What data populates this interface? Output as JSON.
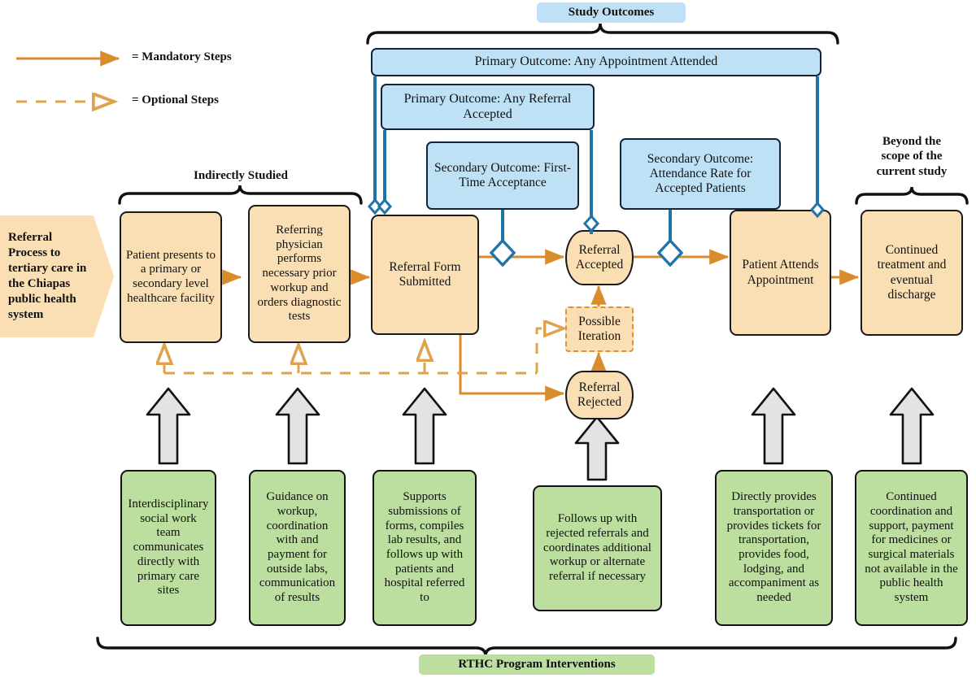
{
  "legend": {
    "mandatory": "= Mandatory Steps",
    "optional": "= Optional Steps"
  },
  "brackets": {
    "study_outcomes": "Study Outcomes",
    "indirectly_studied": "Indirectly Studied",
    "beyond_scope": "Beyond the\nscope of the\ncurrent study",
    "beyond_scope_l1": "Beyond the",
    "beyond_scope_l2": "scope of the",
    "beyond_scope_l3": "current study",
    "rthc": "RTHC Program Interventions"
  },
  "entry_label": "Referral Process to tertiary care in the Chiapas public health system",
  "outcomes": [
    {
      "id": "any-appointment-attended",
      "label": "Primary Outcome: Any Appointment Attended"
    },
    {
      "id": "any-referral-accepted",
      "label": "Primary Outcome: Any Referral Accepted"
    },
    {
      "id": "first-time-acceptance",
      "label": "Secondary Outcome: First-Time Acceptance"
    },
    {
      "id": "attendance-rate",
      "label": "Secondary Outcome: Attendance Rate for Accepted Patients"
    }
  ],
  "process": [
    {
      "id": "patient-presents",
      "label": "Patient presents to a primary or secondary level healthcare facility"
    },
    {
      "id": "referring-physician",
      "label": "Referring physician performs necessary prior workup and orders diagnostic tests"
    },
    {
      "id": "referral-form-submitted",
      "label": "Referral Form Submitted"
    },
    {
      "id": "referral-accepted",
      "label": "Referral Accepted"
    },
    {
      "id": "referral-rejected",
      "label": "Referral Rejected"
    },
    {
      "id": "possible-iteration",
      "label": "Possible Iteration"
    },
    {
      "id": "patient-attends-appointment",
      "label": "Patient Attends Appointment"
    },
    {
      "id": "continued-treatment",
      "label": "Continued treatment and eventual discharge"
    }
  ],
  "interventions": [
    {
      "id": "social-work-team",
      "label": "Interdisciplinary social work team communicates directly with primary care sites"
    },
    {
      "id": "workup-guidance",
      "label": "Guidance on workup, coordination with and payment for outside labs, communication of results"
    },
    {
      "id": "form-support",
      "label": "Supports submissions of forms, compiles lab results, and follows up with patients and hospital referred to"
    },
    {
      "id": "rejection-followup",
      "label": "Follows up with rejected referrals and coordinates additional workup or alternate referral if necessary"
    },
    {
      "id": "transportation-support",
      "label": "Directly provides transportation or provides tickets for transportation, provides food, lodging, and accompaniment as needed"
    },
    {
      "id": "continued-coordination",
      "label": "Continued coordination and support, payment for medicines or surgical materials not available in the public health system"
    }
  ],
  "colors": {
    "process_fill": "#fadfb4",
    "outcome_fill": "#bfe1f5",
    "intervention_fill": "#bcdfa0",
    "mandatory_arrow": "#d98c2b",
    "optional_arrow": "#e0a34d",
    "outcome_line": "#1f74a8",
    "block_arrow_fill": "#e3e3e3",
    "outline": "#111111"
  }
}
